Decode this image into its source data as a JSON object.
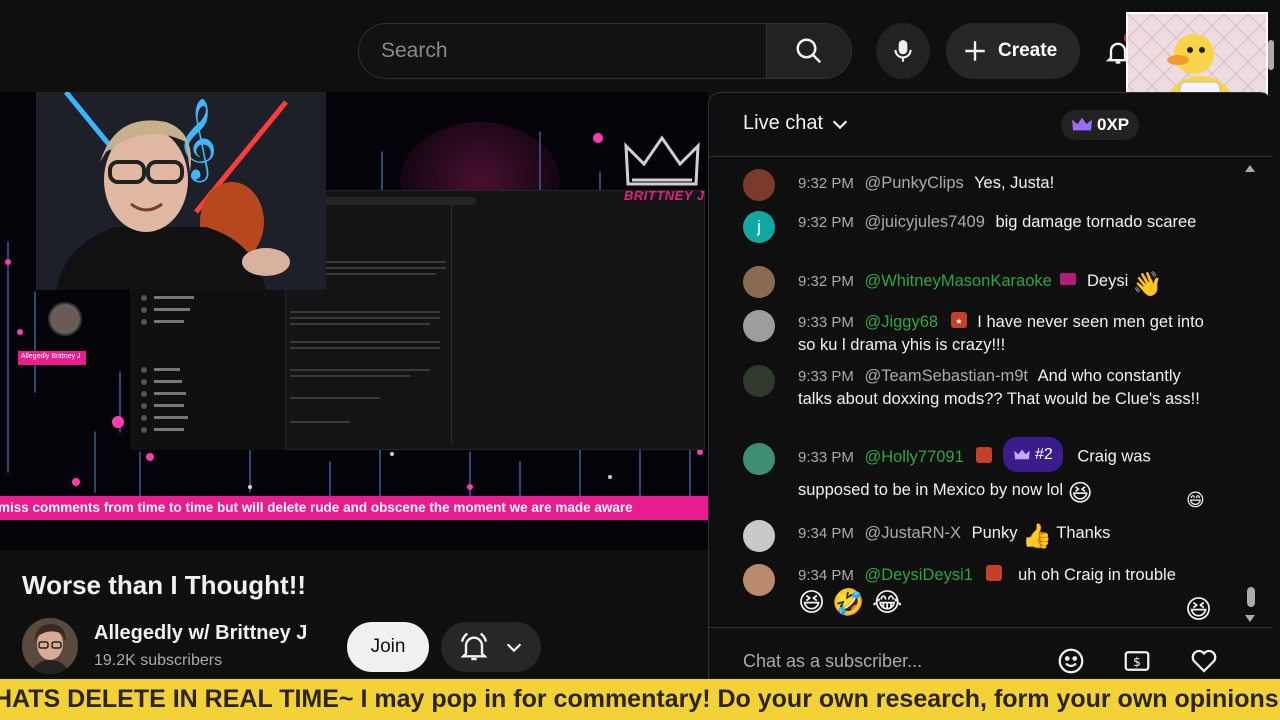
{
  "search": {
    "placeholder": "Search"
  },
  "topbar": {
    "create_label": "Create"
  },
  "video": {
    "overlay_text": "BRITTNEY J",
    "ticker_text": "miss comments from time to time but will delete rude and obscene the moment we are made aware",
    "tag_text": "Allegedly Brittney J"
  },
  "title": "Worse than I Thought!!",
  "channel": {
    "name": "Allegedly w/ Brittney J",
    "subscribers": "19.2K subscribers",
    "join_label": "Join"
  },
  "chat": {
    "title": "Live chat",
    "xp_label": "0XP",
    "input_placeholder": "Chat as a subscriber...",
    "messages": [
      {
        "time": "9:32 PM",
        "author": "@PunkyClips",
        "text": "Yes, Justa!"
      },
      {
        "time": "9:32 PM",
        "author": "@juicyjules7409",
        "text": "big damage tornado scaree"
      },
      {
        "time": "9:32 PM",
        "author": "@WhitneyMasonKaraoke",
        "text": "Deysi"
      },
      {
        "time": "9:33 PM",
        "author": "@Jiggy68",
        "text": "I have never seen men get into so ku l drama yhis is crazy!!!"
      },
      {
        "time": "9:33 PM",
        "author": "@TeamSebastian-m9t",
        "text": "And who constantly talks about doxxing mods?? That would be Clue's ass!!"
      },
      {
        "time": "9:33 PM",
        "author": "@Holly77091",
        "rank": "#2",
        "text": "Craig was supposed to be in Mexico by now lol"
      },
      {
        "time": "9:34 PM",
        "author": "@JustaRN-X",
        "text": "Punky",
        "text2": "Thanks"
      },
      {
        "time": "9:34 PM",
        "author": "@DeysiDeysi1",
        "text": "uh oh Craig in trouble"
      }
    ]
  },
  "bottom_ticker": "HATS DELETE IN REAL TIME~ I may pop in for commentary! Do your own research, form your own opinions",
  "colors": {
    "accent_pink": "#e81c8f",
    "ticker_yellow": "#f2d236",
    "member_green": "#2ba640"
  }
}
